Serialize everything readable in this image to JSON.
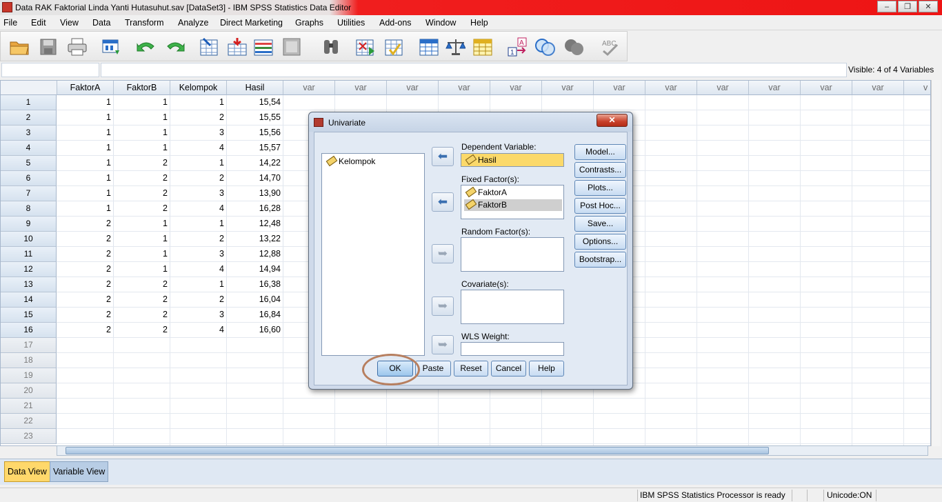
{
  "window": {
    "title": "Data RAK Faktorial Linda Yanti Hutasuhut.sav [DataSet3] - IBM SPSS Statistics Data Editor",
    "minimize": "–",
    "maximize": "❐",
    "close": "✕"
  },
  "menu": [
    "File",
    "Edit",
    "View",
    "Data",
    "Transform",
    "Analyze",
    "Direct Marketing",
    "Graphs",
    "Utilities",
    "Add-ons",
    "Window",
    "Help"
  ],
  "toolbar_icons": [
    "open-folder-icon",
    "save-icon",
    "print-icon",
    "dialog-recall-icon",
    "undo-icon",
    "redo-icon",
    "goto-case-icon",
    "goto-variable-icon",
    "variables-icon",
    "run-descriptives-icon",
    "find-icon",
    "insert-cases-icon",
    "insert-variable-icon",
    "split-file-icon",
    "weight-cases-icon",
    "select-cases-icon",
    "value-labels-icon",
    "use-sets-icon",
    "show-all-variables-icon",
    "spell-check-icon"
  ],
  "visible_vars": "Visible: 4 of 4 Variables",
  "grid": {
    "columns": [
      "FaktorA",
      "FaktorB",
      "Kelompok",
      "Hasil",
      "var",
      "var",
      "var",
      "var",
      "var",
      "var",
      "var",
      "var",
      "var",
      "var",
      "var",
      "var",
      "var",
      "v"
    ],
    "rows": [
      [
        "1",
        "1",
        "1",
        "1",
        "15,54"
      ],
      [
        "2",
        "1",
        "1",
        "2",
        "15,55"
      ],
      [
        "3",
        "1",
        "1",
        "3",
        "15,56"
      ],
      [
        "4",
        "1",
        "1",
        "4",
        "15,57"
      ],
      [
        "5",
        "1",
        "2",
        "1",
        "14,22"
      ],
      [
        "6",
        "1",
        "2",
        "2",
        "14,70"
      ],
      [
        "7",
        "1",
        "2",
        "3",
        "13,90"
      ],
      [
        "8",
        "1",
        "2",
        "4",
        "16,28"
      ],
      [
        "9",
        "2",
        "1",
        "1",
        "12,48"
      ],
      [
        "10",
        "2",
        "1",
        "2",
        "13,22"
      ],
      [
        "11",
        "2",
        "1",
        "3",
        "12,88"
      ],
      [
        "12",
        "2",
        "1",
        "4",
        "14,94"
      ],
      [
        "13",
        "2",
        "2",
        "1",
        "16,38"
      ],
      [
        "14",
        "2",
        "2",
        "2",
        "16,04"
      ],
      [
        "15",
        "2",
        "2",
        "3",
        "16,84"
      ],
      [
        "16",
        "2",
        "2",
        "4",
        "16,60"
      ]
    ],
    "empty_rows": [
      "17",
      "18",
      "19",
      "20",
      "21",
      "22",
      "23"
    ]
  },
  "tabs": {
    "data_view": "Data View",
    "variable_view": "Variable View"
  },
  "status": {
    "processor": "IBM SPSS Statistics Processor is ready",
    "unicode": "Unicode:ON"
  },
  "dialog": {
    "title": "Univariate",
    "close": "✕",
    "source_list": [
      "Kelompok"
    ],
    "dependent_label": "Dependent Variable:",
    "dependent_value": "Hasil",
    "fixed_label": "Fixed Factor(s):",
    "fixed_items": [
      "FaktorA",
      "FaktorB"
    ],
    "random_label": "Random Factor(s):",
    "covariate_label": "Covariate(s):",
    "wls_label": "WLS Weight:",
    "side_buttons": [
      "Model...",
      "Contrasts...",
      "Plots...",
      "Post Hoc...",
      "Save...",
      "Options...",
      "Bootstrap..."
    ],
    "bottom_buttons": {
      "ok": "OK",
      "paste": "Paste",
      "reset": "Reset",
      "cancel": "Cancel",
      "help": "Help"
    }
  }
}
